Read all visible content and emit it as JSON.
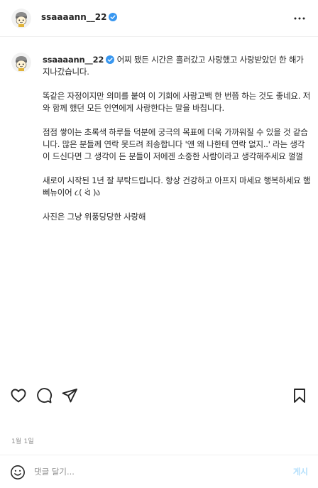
{
  "header": {
    "username": "ssaaaann__22",
    "verified": true,
    "avatar_icon": "avatar-character-icon",
    "more_icon": "more-options-icon"
  },
  "post": {
    "caption_username": "ssaaaann__22",
    "paragraphs": [
      "어찌 됐든 시간은 흘러갔고 사랑했고 사랑받았던 한 해가 지나갔습니다.",
      "똑같은 자정이지만 의미를 붙여 이 기회에 사랑고백 한 번쯤 하는 것도 좋네요. 저와 함께 했던 모든 인연에게 사랑한다는 말을 바칩니다.",
      "점점 쌓이는 초록색 하루들 덕분에 궁극의 목표에 더욱 가까워질 수 있을 것 같습니다. 많은 분들께 연락 못드려 죄송합니다 '얜 왜 나한테 연락 없지..' 라는 생각이 드신다면 그 생각이 든 분들이 저에겐 소중한 사람이라고 생각해주세요 껄껄",
      "새로이 시작된 1년 잘 부탁드립니다. 항상 건강하고 아프지 마세요 행복하세요 햄삐뉴이어 ૮( ᐛ )ა",
      "사진은 그냥 위풍당당한 사랑해"
    ]
  },
  "actions": {
    "like_icon": "heart-icon",
    "comment_icon": "comment-icon",
    "share_icon": "paper-plane-icon",
    "save_icon": "bookmark-icon"
  },
  "date": "1월 1일",
  "comment_bar": {
    "emoji_icon": "emoji-icon",
    "placeholder": "댓글 달기...",
    "post_label": "게시"
  },
  "colors": {
    "verified_badge": "#3897f0",
    "post_button_disabled": "#b2dffc",
    "secondary_text": "#8e8e8e",
    "divider": "#efefef"
  }
}
